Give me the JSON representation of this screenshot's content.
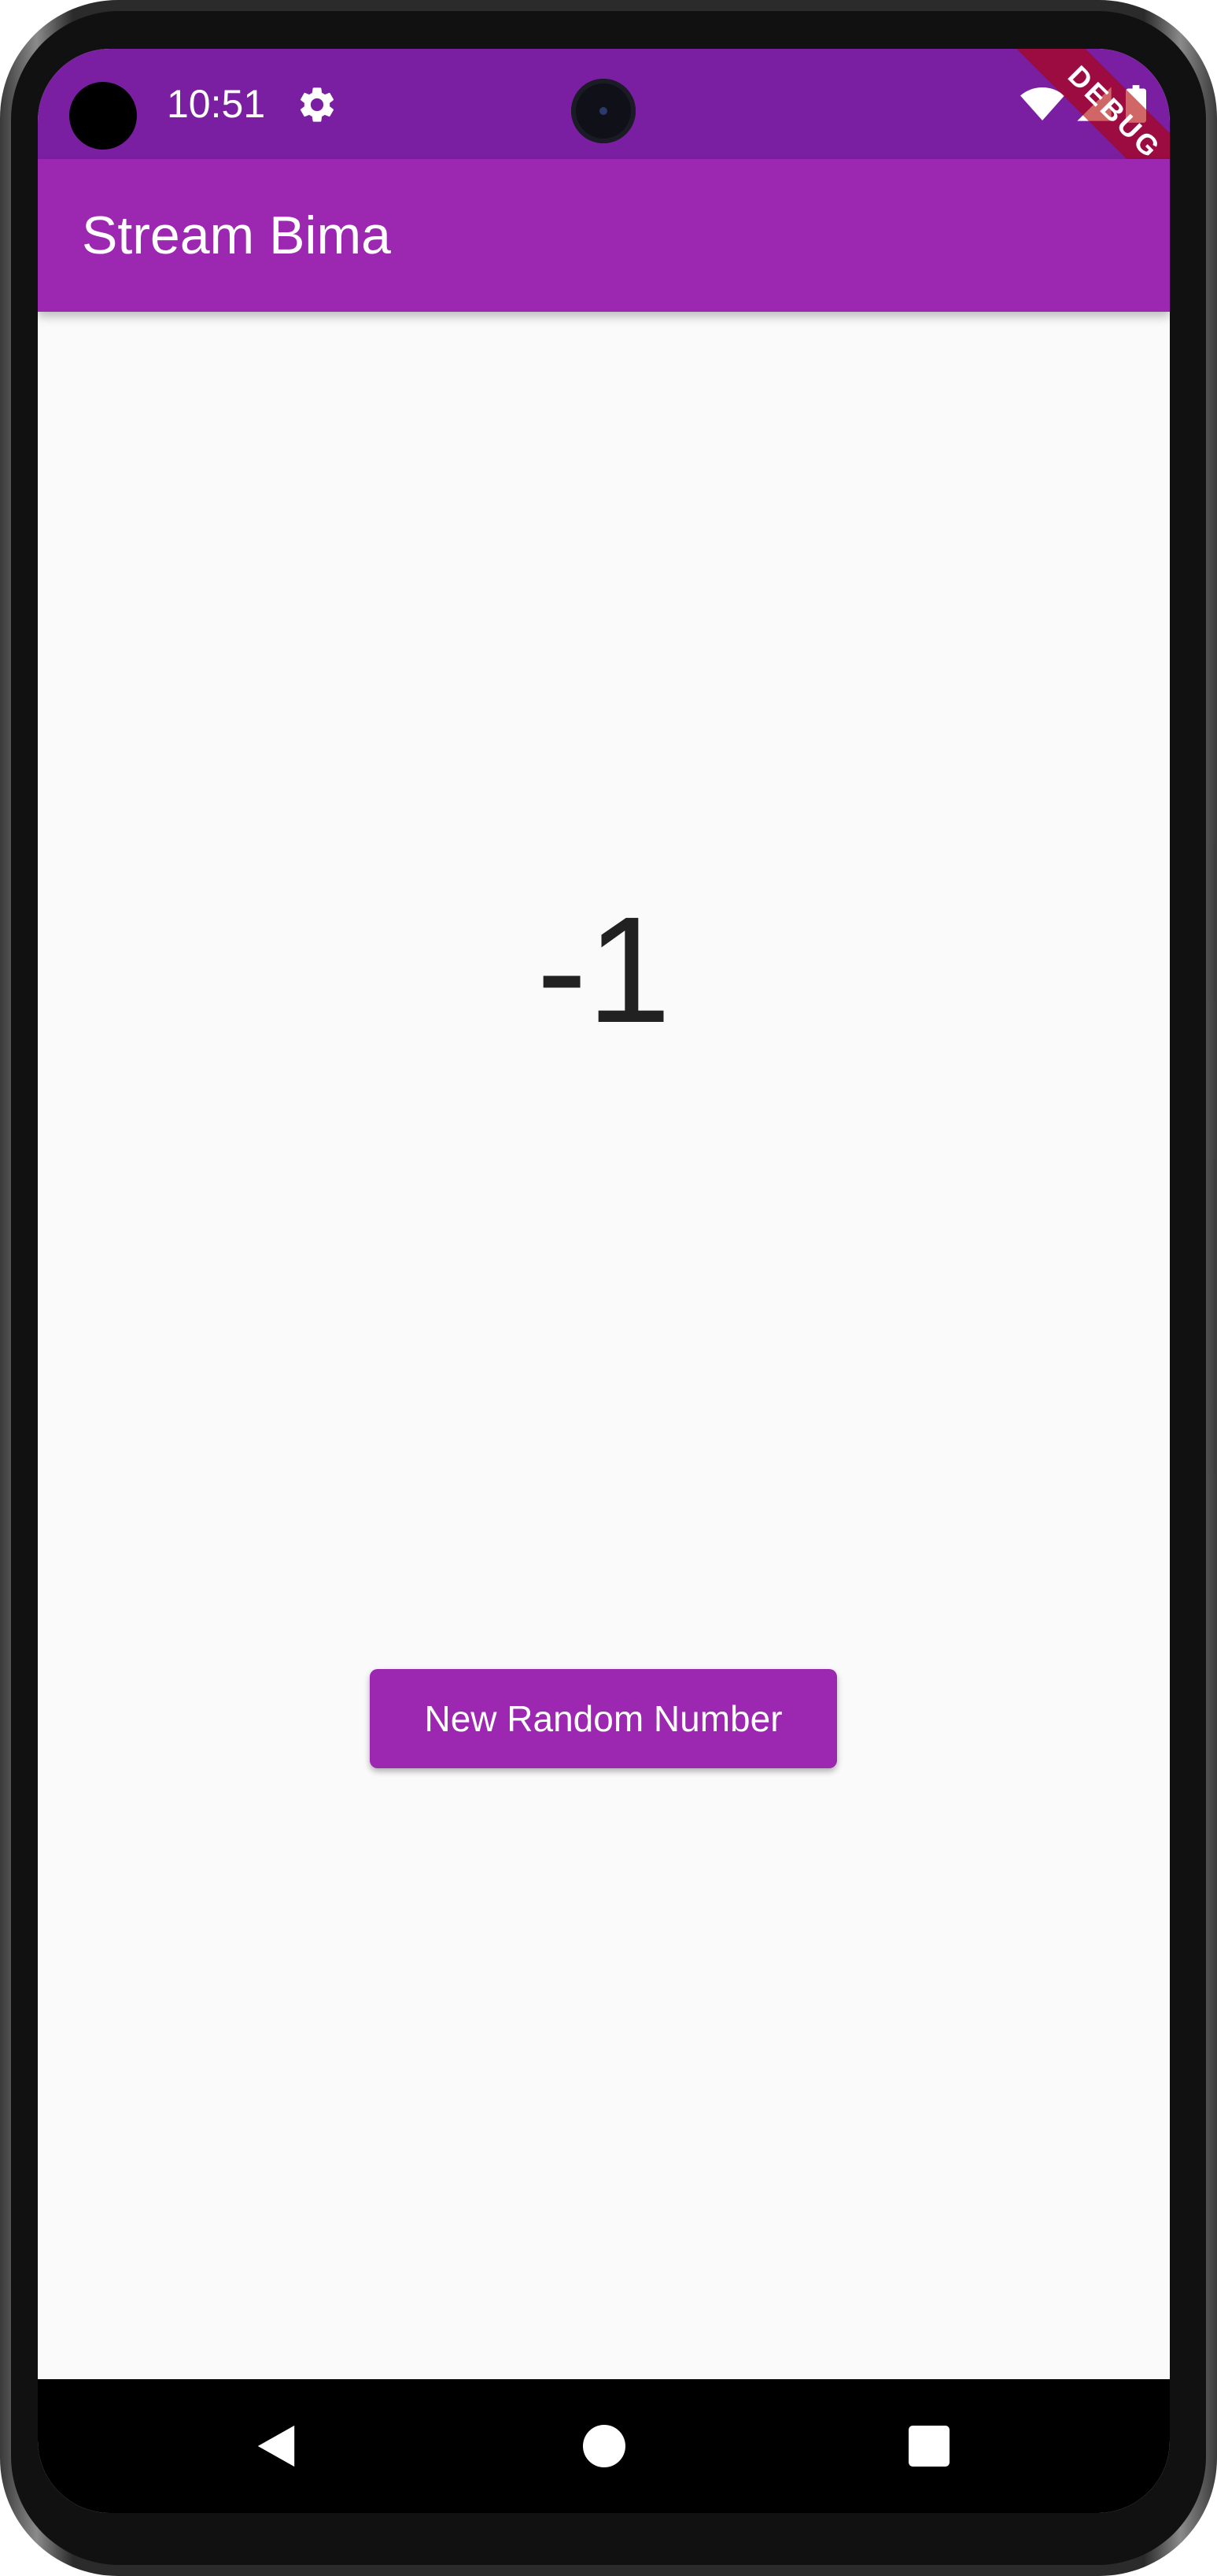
{
  "status_bar": {
    "time": "10:51",
    "icons": [
      "settings-icon",
      "wifi-icon",
      "signal-icon",
      "battery-icon"
    ]
  },
  "debug_banner": "DEBUG",
  "app_bar": {
    "title": "Stream Bima"
  },
  "main": {
    "number": "-1",
    "button_label": "New Random Number"
  },
  "nav_bar": {
    "buttons": [
      "back",
      "home",
      "recents"
    ]
  },
  "colors": {
    "primary": "#9c27b0",
    "primary_dark": "#7b1fa2",
    "background": "#fafafa"
  }
}
